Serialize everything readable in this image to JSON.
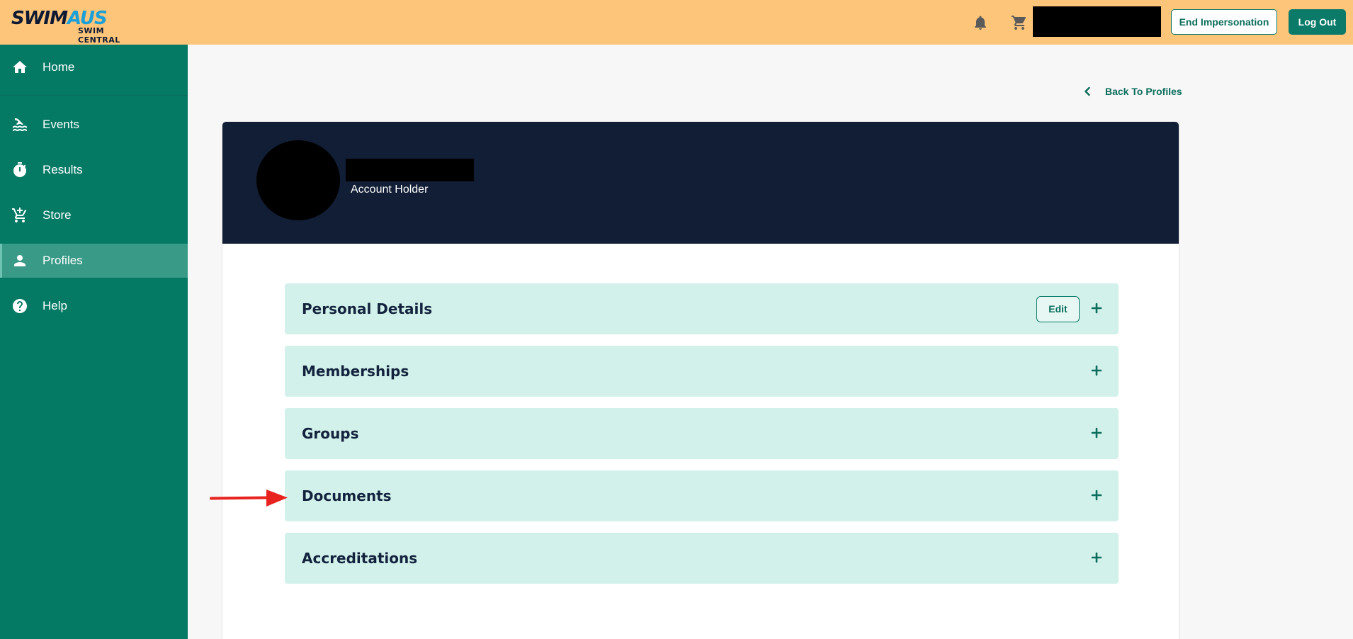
{
  "header": {
    "logo": {
      "brand_main_a": "SWIM",
      "brand_main_b": "AUS",
      "brand_sub": "SWIM CENTRAL"
    },
    "icons": {
      "notifications": "bell-icon",
      "cart": "cart-icon"
    },
    "end_impersonation_label": "End Impersonation",
    "logout_label": "Log Out"
  },
  "sidebar": {
    "items": [
      {
        "label": "Home",
        "icon": "home-icon"
      },
      {
        "label": "Events",
        "icon": "swimming-icon"
      },
      {
        "label": "Results",
        "icon": "stopwatch-icon"
      },
      {
        "label": "Store",
        "icon": "cart-icon"
      },
      {
        "label": "Profiles",
        "icon": "person-icon",
        "active": true
      },
      {
        "label": "Help",
        "icon": "help-icon"
      }
    ]
  },
  "main": {
    "back_link": "Back To Profiles",
    "profile": {
      "role": "Account Holder"
    },
    "sections": [
      {
        "title": "Personal Details",
        "edit_label": "Edit"
      },
      {
        "title": "Memberships"
      },
      {
        "title": "Groups"
      },
      {
        "title": "Documents"
      },
      {
        "title": "Accreditations"
      }
    ]
  },
  "colors": {
    "topbar": "#fcc57a",
    "sidebar": "#047a65",
    "sidebar_active": "#3a9a88",
    "card_header": "#111e35",
    "section_bg": "#d2f1eb",
    "accent": "#0b7a68",
    "annotation_arrow": "#e8231f"
  }
}
